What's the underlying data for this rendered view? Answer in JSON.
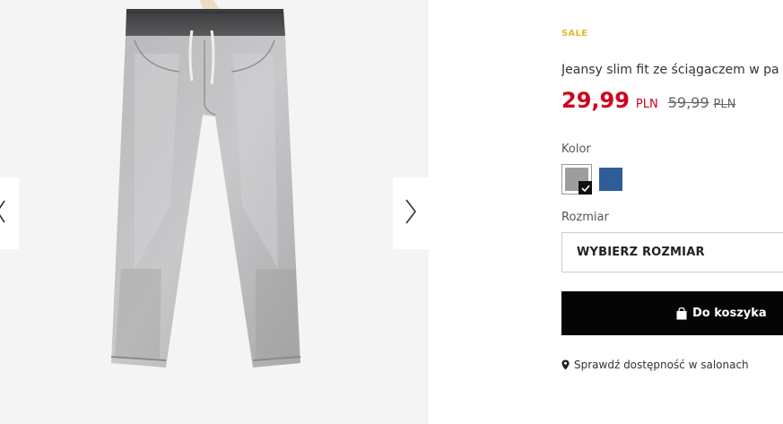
{
  "gallery": {
    "image_alt": "Jeansy slim fit ze ściągaczem w pasie",
    "prev_icon": "chevron-left-icon",
    "next_icon": "chevron-right-icon"
  },
  "product": {
    "badge": "SALE",
    "title": "Jeansy slim fit ze ściągaczem w pa",
    "price_new": "29,99",
    "price_new_currency": "PLN",
    "price_old": "59,99",
    "price_old_currency": "PLN"
  },
  "color": {
    "label": "Kolor",
    "swatches": [
      {
        "name": "grey",
        "hex": "#9d9d9d",
        "selected": true
      },
      {
        "name": "blue",
        "hex": "#2f5d9a",
        "selected": false
      }
    ]
  },
  "size": {
    "label": "Rozmiar",
    "select_value": "WYBIERZ ROZMIAR"
  },
  "cart": {
    "button_label": "Do koszyka",
    "icon": "shopping-bag-icon"
  },
  "availability": {
    "text": "Sprawdź dostępność w salonach",
    "icon": "map-pin-icon"
  },
  "colors": {
    "sale_badge": "#e8b62e",
    "price_new": "#d0021b",
    "button_bg": "#050505"
  }
}
